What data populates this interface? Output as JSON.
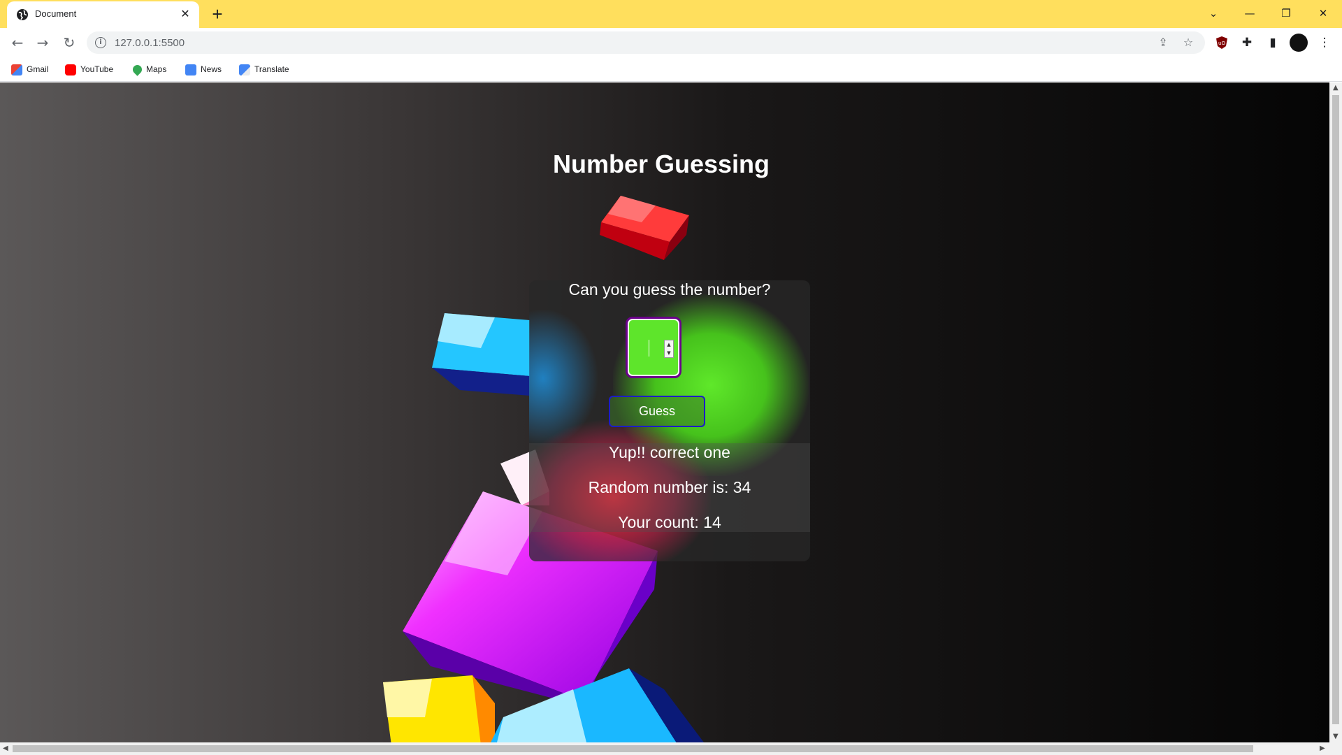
{
  "browser": {
    "tab_title": "Document",
    "url": "127.0.0.1:5500",
    "bookmarks": [
      {
        "label": "Gmail",
        "icon": "gmail-icon",
        "color": "#ea4335"
      },
      {
        "label": "YouTube",
        "icon": "youtube-icon",
        "color": "#ff0000"
      },
      {
        "label": "Maps",
        "icon": "maps-icon",
        "color": "#34a853"
      },
      {
        "label": "News",
        "icon": "news-icon",
        "color": "#4285f4"
      },
      {
        "label": "Translate",
        "icon": "translate-icon",
        "color": "#4285f4"
      }
    ],
    "chrome_color": "#ffdf5d"
  },
  "page": {
    "title": "Number Guessing",
    "question": "Can you guess the number?",
    "input": {
      "value": ""
    },
    "guess_label": "Guess",
    "result_message": "Yup!! correct one",
    "random_number_text": "Random number is: 34",
    "count_text": "Your count: 14"
  },
  "colors": {
    "input_bg": "#5ee52b",
    "input_border": "#6a008a",
    "button_border": "#1c1cc8"
  }
}
